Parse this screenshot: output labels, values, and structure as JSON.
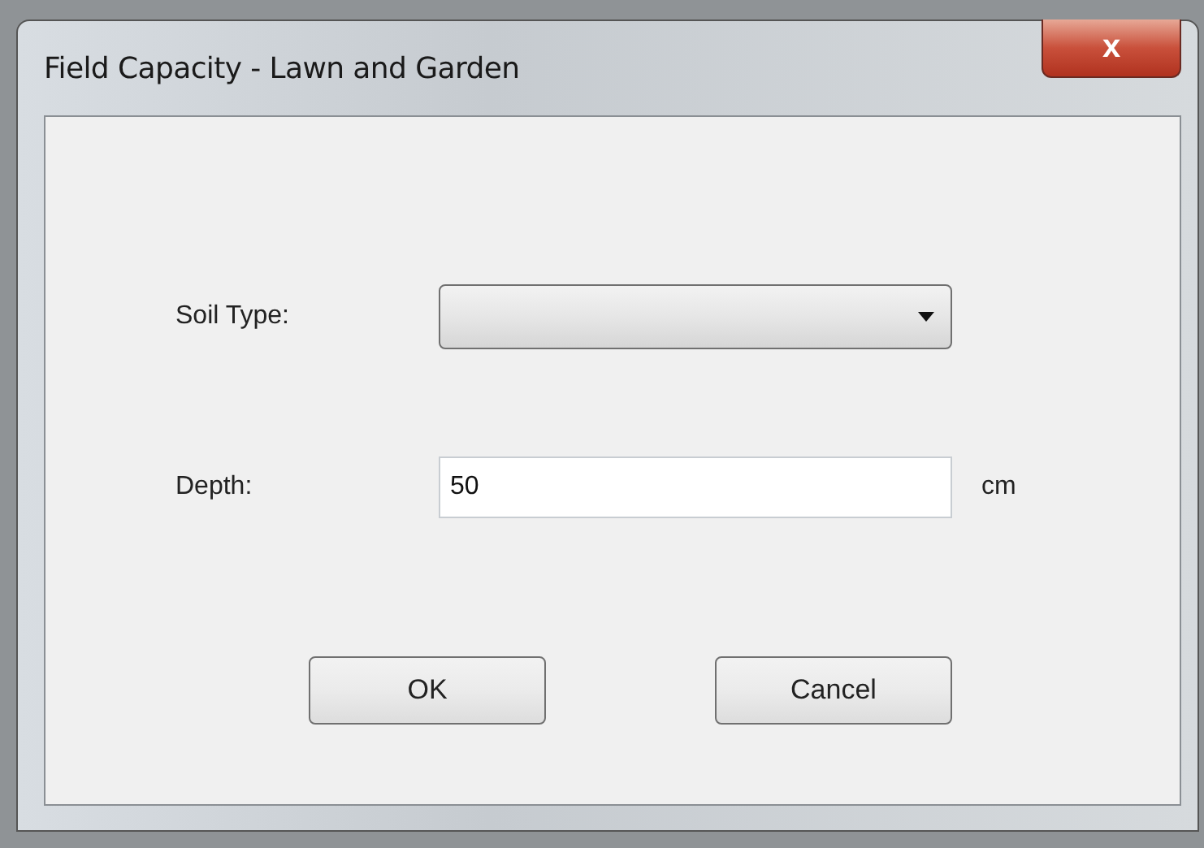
{
  "window": {
    "title": "Field Capacity - Lawn and Garden",
    "close": "x"
  },
  "fields": [
    {
      "kind": "dropdown",
      "label": "Soil Type:",
      "expanded": false
    },
    {
      "kind": "text",
      "label": "Depth:",
      "value": "50",
      "unit": "cm"
    }
  ],
  "buttons": [
    "OK",
    "Cancel"
  ]
}
